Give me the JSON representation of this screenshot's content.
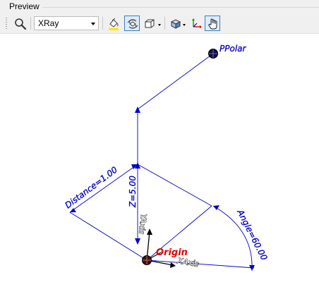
{
  "panel": {
    "title": "Preview"
  },
  "toolbar": {
    "render_mode": {
      "value": "XRay",
      "options": [
        "XRay"
      ]
    },
    "buttons": [
      {
        "id": "zoom",
        "icon": "magnifier-icon"
      },
      {
        "id": "background-color",
        "icon": "paint-bucket-icon"
      },
      {
        "id": "rotate-view",
        "icon": "rotate-view-icon",
        "active": true
      },
      {
        "id": "view-box",
        "icon": "view-box-icon"
      },
      {
        "id": "view-orientation",
        "icon": "view-cube-icon"
      },
      {
        "id": "axes",
        "icon": "axes-icon"
      },
      {
        "id": "pan",
        "icon": "hand-icon",
        "active": true
      }
    ]
  },
  "scene": {
    "points": [
      {
        "name": "ppolar",
        "label": "PPolar"
      },
      {
        "name": "origin",
        "label": "Origin"
      }
    ],
    "dimensions": {
      "distance": "Distance=1.00",
      "height": "Z=5.00",
      "angle": "Angle=60.00"
    },
    "axes": {
      "x": "XAxis",
      "y": "YAxis"
    },
    "colors": {
      "dimension": "#0000e6",
      "origin_label": "#e00000",
      "point_marker": "#101040",
      "axis_x": "#e00000",
      "axis_y": "#00a000"
    }
  }
}
